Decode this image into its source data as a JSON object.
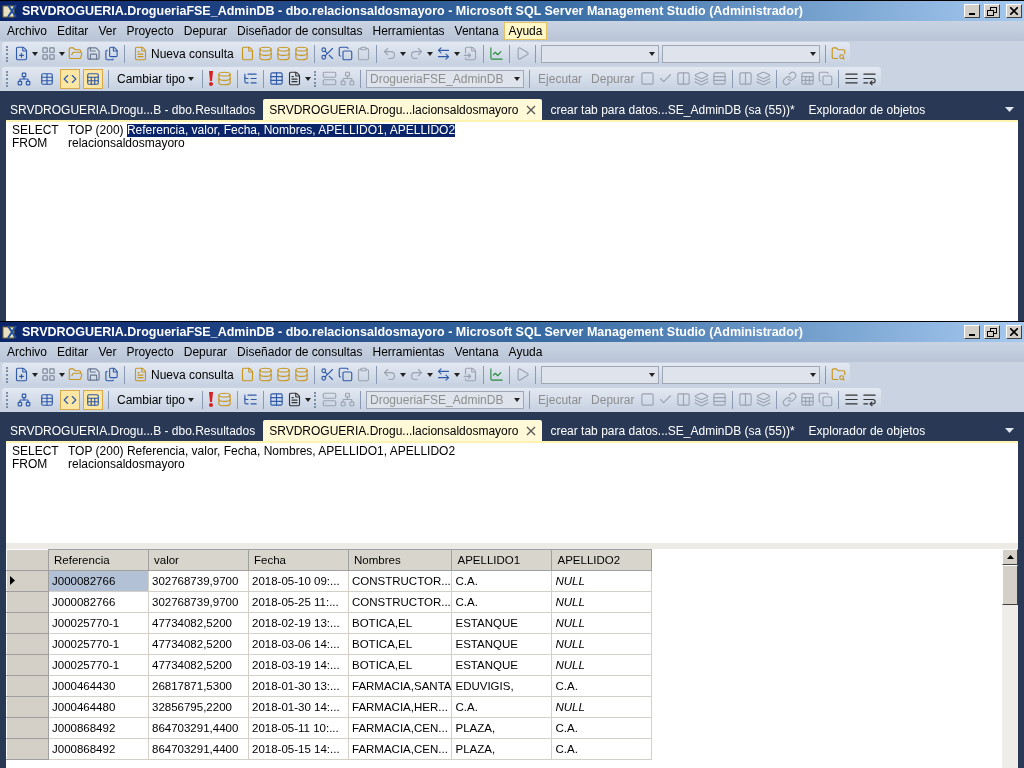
{
  "windows": [
    {
      "title": "SRVDROGUERIA.DrogueriaFSE_AdminDB - dbo.relacionsaldosmayoro - Microsoft SQL Server Management Studio (Administrador)",
      "menu": [
        {
          "label": "Archivo",
          "selected": false
        },
        {
          "label": "Editar",
          "selected": false
        },
        {
          "label": "Ver",
          "selected": false
        },
        {
          "label": "Proyecto",
          "selected": false
        },
        {
          "label": "Depurar",
          "selected": false
        },
        {
          "label": "Diseñador de consultas",
          "selected": false
        },
        {
          "label": "Herramientas",
          "selected": false
        },
        {
          "label": "Ventana",
          "selected": false
        },
        {
          "label": "Ayuda",
          "selected": true
        }
      ],
      "toolbar": {
        "new_query": "Nueva consulta",
        "change_type": "Cambiar tipo",
        "pane_toggles": [
          {
            "pressed": false
          },
          {
            "pressed": false
          },
          {
            "pressed": true
          },
          {
            "pressed": true
          }
        ],
        "database": {
          "value": "DrogueriaFSE_AdminDB",
          "disabled": true
        },
        "execute": {
          "label": "Ejecutar",
          "disabled": true
        },
        "debug": {
          "label": "Depurar",
          "disabled": true
        }
      },
      "tabs": [
        {
          "label": "SRVDROGUERIA.Drogu...B - dbo.Resultados",
          "selected": false
        },
        {
          "label": "SRVDROGUERIA.Drogu...lacionsaldosmayoro",
          "selected": true
        },
        {
          "label": "crear tab para datos...SE_AdminDB (sa (55))*",
          "selected": false
        },
        {
          "label": "Explorador de objetos",
          "selected": false
        }
      ],
      "query": [
        {
          "keyword": "SELECT",
          "parts": [
            {
              "text": "TOP (200) ",
              "selected": false
            },
            {
              "text": "Referencia, valor, Fecha, Nombres, APELLIDO1, APELLIDO2",
              "selected": true
            }
          ]
        },
        {
          "keyword": "FROM",
          "parts": [
            {
              "text": "relacionsaldosmayoro",
              "selected": false
            }
          ]
        }
      ]
    },
    {
      "title": "SRVDROGUERIA.DrogueriaFSE_AdminDB - dbo.relacionsaldosmayoro - Microsoft SQL Server Management Studio (Administrador)",
      "menu": [
        {
          "label": "Archivo",
          "selected": false
        },
        {
          "label": "Editar",
          "selected": false
        },
        {
          "label": "Ver",
          "selected": false
        },
        {
          "label": "Proyecto",
          "selected": false
        },
        {
          "label": "Depurar",
          "selected": false
        },
        {
          "label": "Diseñador de consultas",
          "selected": false
        },
        {
          "label": "Herramientas",
          "selected": false
        },
        {
          "label": "Ventana",
          "selected": false
        },
        {
          "label": "Ayuda",
          "selected": false
        }
      ],
      "toolbar": {
        "new_query": "Nueva consulta",
        "change_type": "Cambiar tipo",
        "pane_toggles": [
          {
            "pressed": false
          },
          {
            "pressed": false
          },
          {
            "pressed": true
          },
          {
            "pressed": true
          }
        ],
        "database": {
          "value": "DrogueriaFSE_AdminDB",
          "disabled": true
        },
        "execute": {
          "label": "Ejecutar",
          "disabled": true
        },
        "debug": {
          "label": "Depurar",
          "disabled": true
        }
      },
      "tabs": [
        {
          "label": "SRVDROGUERIA.Drogu...B - dbo.Resultados",
          "selected": false
        },
        {
          "label": "SRVDROGUERIA.Drogu...lacionsaldosmayoro",
          "selected": true
        },
        {
          "label": "crear tab para datos...SE_AdminDB (sa (55))*",
          "selected": false
        },
        {
          "label": "Explorador de objetos",
          "selected": false
        }
      ],
      "query": [
        {
          "keyword": "SELECT",
          "parts": [
            {
              "text": "TOP (200) Referencia, valor, Fecha, Nombres, APELLIDO1, APELLIDO2",
              "selected": false
            }
          ]
        },
        {
          "keyword": "FROM",
          "parts": [
            {
              "text": "relacionsaldosmayoro",
              "selected": false
            }
          ]
        }
      ],
      "results": {
        "columns": [
          "Referencia",
          "valor",
          "Fecha",
          "Nombres",
          "APELLIDO1",
          "APELLIDO2"
        ],
        "rows": [
          {
            "selected": true,
            "cells": [
              {
                "text": "J000082766",
                "kind": "value"
              },
              {
                "text": "302768739,9700",
                "kind": "value"
              },
              {
                "text": "2018-05-10 09:...",
                "kind": "value"
              },
              {
                "text": "CONSTRUCTOR...",
                "kind": "value"
              },
              {
                "text": "C.A.",
                "kind": "value"
              },
              {
                "text": "NULL",
                "kind": "null"
              }
            ]
          },
          {
            "selected": false,
            "cells": [
              {
                "text": "J000082766",
                "kind": "value"
              },
              {
                "text": "302768739,9700",
                "kind": "value"
              },
              {
                "text": "2018-05-25 11:...",
                "kind": "value"
              },
              {
                "text": "CONSTRUCTOR...",
                "kind": "value"
              },
              {
                "text": "C.A.",
                "kind": "value"
              },
              {
                "text": "NULL",
                "kind": "null"
              }
            ]
          },
          {
            "selected": false,
            "cells": [
              {
                "text": "J00025770-1",
                "kind": "value"
              },
              {
                "text": "47734082,5200",
                "kind": "value"
              },
              {
                "text": "2018-02-19 13:...",
                "kind": "value"
              },
              {
                "text": "BOTICA,EL",
                "kind": "value"
              },
              {
                "text": "ESTANQUE",
                "kind": "value"
              },
              {
                "text": "NULL",
                "kind": "null"
              }
            ]
          },
          {
            "selected": false,
            "cells": [
              {
                "text": "J00025770-1",
                "kind": "value"
              },
              {
                "text": "47734082,5200",
                "kind": "value"
              },
              {
                "text": "2018-03-06 14:...",
                "kind": "value"
              },
              {
                "text": "BOTICA,EL",
                "kind": "value"
              },
              {
                "text": "ESTANQUE",
                "kind": "value"
              },
              {
                "text": "NULL",
                "kind": "null"
              }
            ]
          },
          {
            "selected": false,
            "cells": [
              {
                "text": "J00025770-1",
                "kind": "value"
              },
              {
                "text": "47734082,5200",
                "kind": "value"
              },
              {
                "text": "2018-03-19 14:...",
                "kind": "value"
              },
              {
                "text": "BOTICA,EL",
                "kind": "value"
              },
              {
                "text": "ESTANQUE",
                "kind": "value"
              },
              {
                "text": "NULL",
                "kind": "null"
              }
            ]
          },
          {
            "selected": false,
            "cells": [
              {
                "text": "J000464430",
                "kind": "value"
              },
              {
                "text": "26817871,5300",
                "kind": "value"
              },
              {
                "text": "2018-01-30 13:...",
                "kind": "value"
              },
              {
                "text": "FARMACIA,SANTA",
                "kind": "value"
              },
              {
                "text": "EDUVIGIS,",
                "kind": "value"
              },
              {
                "text": "C.A.",
                "kind": "value"
              }
            ]
          },
          {
            "selected": false,
            "cells": [
              {
                "text": "J000464480",
                "kind": "value"
              },
              {
                "text": "32856795,2200",
                "kind": "value"
              },
              {
                "text": "2018-01-30 14:...",
                "kind": "value"
              },
              {
                "text": "FARMACIA,HER...",
                "kind": "value"
              },
              {
                "text": "C.A.",
                "kind": "value"
              },
              {
                "text": "NULL",
                "kind": "null"
              }
            ]
          },
          {
            "selected": false,
            "cells": [
              {
                "text": "J000868492",
                "kind": "value"
              },
              {
                "text": "864703291,4400",
                "kind": "value"
              },
              {
                "text": "2018-05-11 10:...",
                "kind": "value"
              },
              {
                "text": "FARMACIA,CEN...",
                "kind": "value"
              },
              {
                "text": "PLAZA,",
                "kind": "value"
              },
              {
                "text": "C.A.",
                "kind": "value"
              }
            ]
          },
          {
            "selected": false,
            "cells": [
              {
                "text": "J000868492",
                "kind": "value"
              },
              {
                "text": "864703291,4400",
                "kind": "value"
              },
              {
                "text": "2018-05-15 14:...",
                "kind": "value"
              },
              {
                "text": "FARMACIA,CEN...",
                "kind": "value"
              },
              {
                "text": "PLAZA,",
                "kind": "value"
              },
              {
                "text": "C.A.",
                "kind": "value"
              }
            ]
          }
        ]
      }
    }
  ]
}
